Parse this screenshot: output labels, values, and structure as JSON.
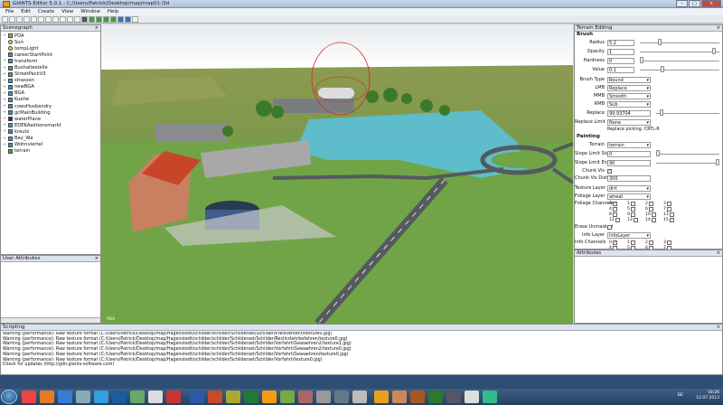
{
  "window": {
    "title": "GIANTS Editor 5.0.1 - C:/Users/Patrick/Desktop/map/map01.i3d"
  },
  "menu": [
    "File",
    "Edit",
    "Create",
    "View",
    "Window",
    "Help"
  ],
  "scenegraph": {
    "title": "Scenegraph",
    "items": [
      {
        "label": "PDA",
        "icon": "camera-icon",
        "expand": "+"
      },
      {
        "label": "Sun",
        "icon": "light-icon",
        "expand": ""
      },
      {
        "label": "tempLight",
        "icon": "light-icon",
        "expand": ""
      },
      {
        "label": "careerStartPoint",
        "icon": "transform-icon",
        "expand": ""
      },
      {
        "label": "transform",
        "icon": "group-icon",
        "expand": "+"
      },
      {
        "label": "Bushaltestelle",
        "icon": "group-icon",
        "expand": "+"
      },
      {
        "label": "StreetPackV3",
        "icon": "group-icon",
        "expand": "+"
      },
      {
        "label": "strassen",
        "icon": "group-icon",
        "expand": "+"
      },
      {
        "label": "newBGA",
        "icon": "group-icon",
        "expand": "+"
      },
      {
        "label": "BGA",
        "icon": "group-icon",
        "expand": "+"
      },
      {
        "label": "Kuehe",
        "icon": "group-icon",
        "expand": "+"
      },
      {
        "label": "cowsHusbandry",
        "icon": "group-icon",
        "expand": "+"
      },
      {
        "label": "gcMainBuilding",
        "icon": "group-icon",
        "expand": "+"
      },
      {
        "label": "waterPlane",
        "icon": "shape-icon",
        "expand": "+"
      },
      {
        "label": "EDEKAaktionsmarkt",
        "icon": "group-icon",
        "expand": "+"
      },
      {
        "label": "kreutz",
        "icon": "group-icon",
        "expand": "+"
      },
      {
        "label": "Bay_Wa",
        "icon": "group-icon",
        "expand": "+"
      },
      {
        "label": "Wohnviertel",
        "icon": "group-icon",
        "expand": "+"
      },
      {
        "label": "terrain",
        "icon": "terrain-icon",
        "expand": ""
      }
    ]
  },
  "user_attributes": {
    "title": "User Attributes"
  },
  "viewport": {
    "label": "PDA"
  },
  "terrain_editing": {
    "title": "Terrain Editing",
    "brush_header": "Brush",
    "radius_label": "Radius",
    "radius": "5.2",
    "opacity_label": "Opacity",
    "opacity": "1",
    "hardness_label": "Hardness",
    "hardness": "0",
    "value_label": "Value",
    "value": "0.1",
    "brush_type_label": "Brush Type",
    "brush_type": "Round",
    "lmb_label": "LMB",
    "lmb": "Replace",
    "mmb_label": "MMB",
    "mmb": "Smooth",
    "rmb_label": "RMB",
    "rmb": "Sub",
    "replace_label": "Replace",
    "replace": "99.93704",
    "replace_limit_label": "Replace Limit",
    "replace_limit": "None",
    "replace_picking": "Replace picking: CRTL-R",
    "painting_header": "Painting",
    "terrain_label": "Terrain",
    "terrain": "terrain",
    "slope_start_label": "Slope Limit Start",
    "slope_start": "0",
    "slope_end_label": "Slope Limit End",
    "slope_end": "90",
    "chunk_vis_label": "Chunk Vis",
    "chunk_dist_label": "Chunk Vis Dist",
    "chunk_dist": "300",
    "texture_layer_label": "Texture Layer",
    "texture_layer": "dirt",
    "foliage_layer_label": "Foliage Layer",
    "foliage_layer": "wheat",
    "foliage_channels_label": "Foliage Channels",
    "foliage_channels": [
      "0",
      "1",
      "2",
      "3",
      "4",
      "5",
      "6",
      "7",
      "8",
      "9",
      "10",
      "11",
      "12",
      "13",
      "14",
      "15"
    ],
    "erase_unmasked_label": "Erase Unmasked",
    "info_layer_label": "Info Layer",
    "info_layer": "infoLayer",
    "info_channels_label": "Info Channels",
    "info_channels": [
      "0",
      "1",
      "2",
      "3",
      "4",
      "5",
      "6",
      "7"
    ]
  },
  "attributes": {
    "title": "Attributes"
  },
  "scripting": {
    "title": "Scripting",
    "lines": [
      "Warning (performance): Raw texture format (C:/Users/Patrick/Desktop/map/Hagenstedt/schilder/schilder/Schilderset/Schilder/Kreisverkehr/texture0.jpg)",
      "Warning (performance): Raw texture format (C:/Users/Patrick/Desktop/map/Hagenstedt/schilder/schilder/Schilderset/Schilder/Rechtsfahrbefahren/texture0.jpg)",
      "Warning (performance): Raw texture format (C:/Users/Patrick/Desktop/map/Hagenstedt/schilder/schilder/Schilderset/Schilder/Vorfahrt/Gewaehren2/texture1.jpg)",
      "Warning (performance): Raw texture format (C:/Users/Patrick/Desktop/map/Hagenstedt/schilder/schilder/Schilderset/Schilder/Vorfahrt/Gewaehren2/texture0.jpg)",
      "Warning (performance): Raw texture format (C:/Users/Patrick/Desktop/map/Hagenstedt/schilder/schilder/Schilderset/Schilder/Vorfahrt/Gewaehren/texture0.jpg)",
      "Warning (performance): Raw texture format (C:/Users/Patrick/Desktop/map/Hagenstedt/schilder/schilder/Schilderset/Schilder/Vorfahrt/texture0.jpg)",
      "Check for updates (http://gdn.giants-software.com)"
    ]
  },
  "tray": {
    "lang": "DE",
    "time": "18:26",
    "date": "12.07.2013"
  },
  "colors": {
    "grass": "#6fa043",
    "water": "#5bbfd6",
    "road": "#555a5e"
  }
}
